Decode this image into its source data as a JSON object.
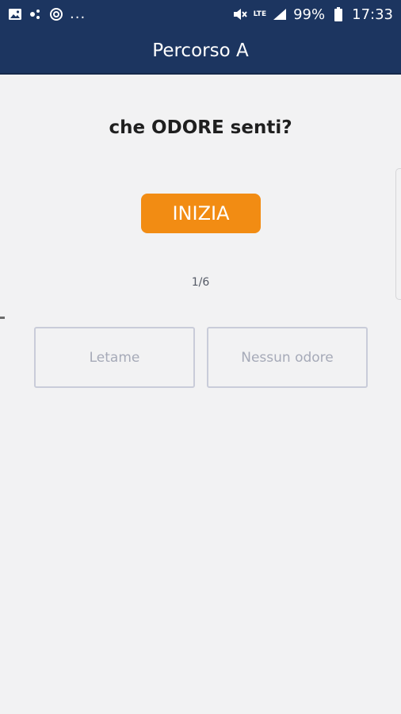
{
  "status_bar": {
    "icons_left": [
      "image-icon",
      "notification-dots-icon",
      "sync-icon"
    ],
    "overflow": "...",
    "network": "LTE",
    "battery": "99%",
    "time": "17:33"
  },
  "app_bar": {
    "title": "Percorso A"
  },
  "main": {
    "question": "che ODORE senti?",
    "start_button": "INIZIA",
    "progress": "1/6",
    "answers": [
      "Letame",
      "Nessun odore"
    ]
  },
  "colors": {
    "header": "#1c3560",
    "accent": "#f28c13",
    "background": "#f2f2f3",
    "answer_border": "#c9ccd9",
    "answer_text": "#a6aab8"
  }
}
